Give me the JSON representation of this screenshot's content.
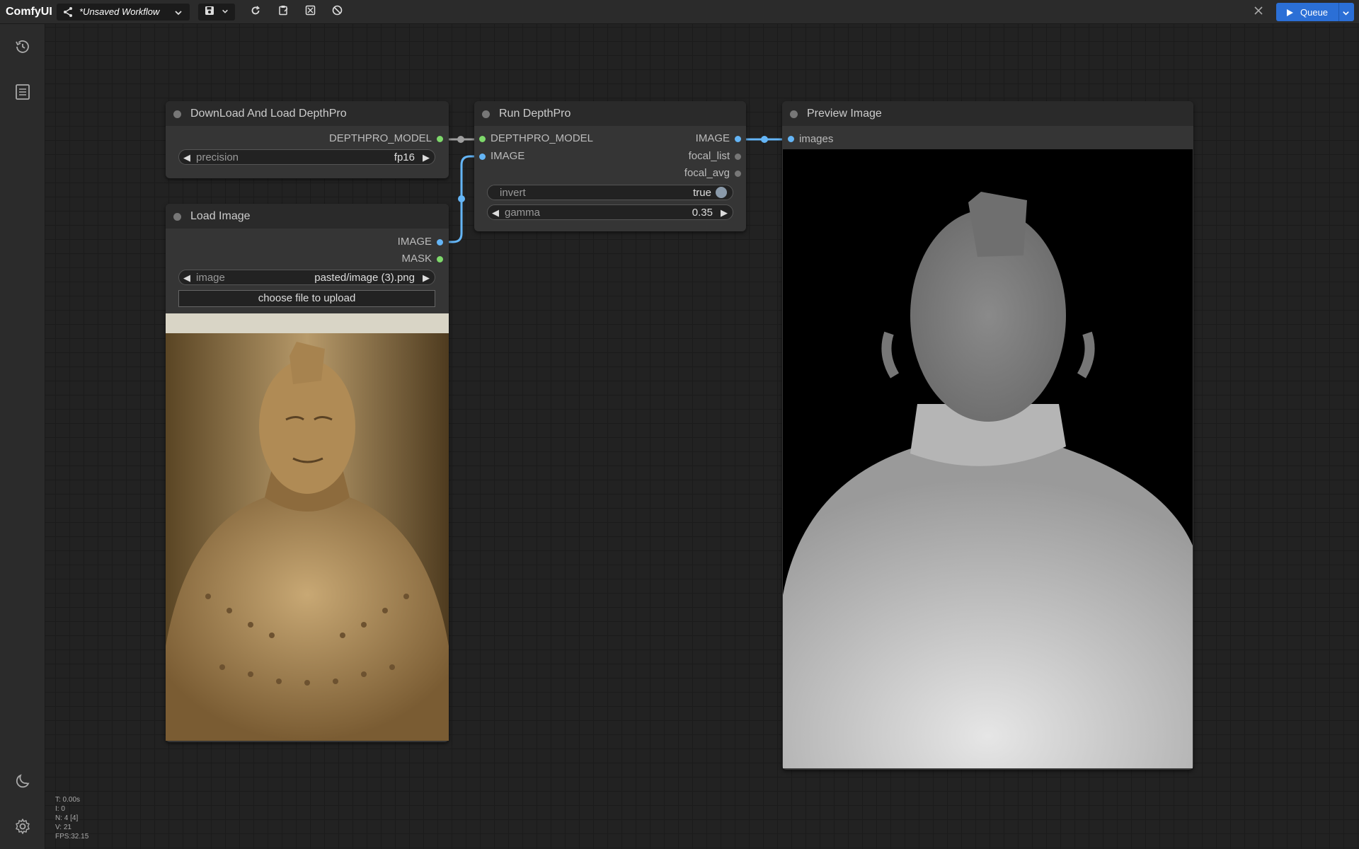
{
  "app": {
    "brand": "ComfyUI",
    "workflow_title": "*Unsaved Workflow"
  },
  "queue": {
    "label": "Queue"
  },
  "colors": {
    "model_link": "#9e9e9e",
    "image_link": "#64b5f6",
    "model_slot": "#7ed96b",
    "mask_slot": "#7ed96b",
    "image_slot": "#64b5f6",
    "queue_bg": "#2b6fd6"
  },
  "icons": {
    "share": "share-icon",
    "save": "save-icon",
    "refresh": "refresh-icon",
    "clipboard": "clipboard-icon",
    "fit": "fit-view-icon",
    "cancel": "cancel-icon",
    "history": "history-icon",
    "library": "library-icon",
    "theme": "moon-icon",
    "settings": "gear-icon",
    "close": "close-icon"
  },
  "nodes": {
    "download": {
      "title": "DownLoad And Load DepthPro",
      "output": "DEPTHPRO_MODEL",
      "precision": {
        "label": "precision",
        "value": "fp16"
      }
    },
    "load_image": {
      "title": "Load Image",
      "outputs": [
        "IMAGE",
        "MASK"
      ],
      "image": {
        "label": "image",
        "value": "pasted/image (3).png"
      },
      "upload_label": "choose file to upload"
    },
    "run_depthpro": {
      "title": "Run DepthPro",
      "inputs": [
        "DEPTHPRO_MODEL",
        "IMAGE"
      ],
      "outputs": [
        "IMAGE",
        "focal_list",
        "focal_avg"
      ],
      "invert": {
        "label": "invert",
        "value": "true"
      },
      "gamma": {
        "label": "gamma",
        "value": "0.35"
      }
    },
    "preview": {
      "title": "Preview Image",
      "input": "images"
    }
  },
  "stats": {
    "t": "T: 0.00s",
    "i": "I: 0",
    "n": "N: 4 [4]",
    "v": "V: 21",
    "fps": "FPS:32.15"
  }
}
